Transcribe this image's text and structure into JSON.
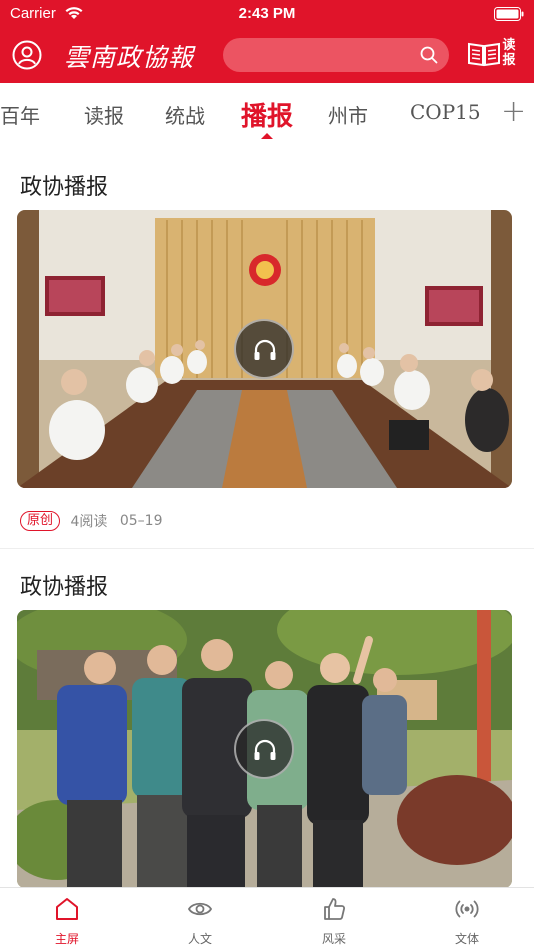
{
  "status_bar": {
    "carrier": "Carrier",
    "time": "2:43 PM"
  },
  "header": {
    "logo_text": "雲南政協報",
    "search": {
      "placeholder": ""
    },
    "read_label": "读报"
  },
  "channel_tabs": [
    {
      "label": "百年",
      "active": false
    },
    {
      "label": "读报",
      "active": false
    },
    {
      "label": "统战",
      "active": false
    },
    {
      "label": "播报",
      "active": true
    },
    {
      "label": "州市",
      "active": false
    },
    {
      "label": "COP15",
      "active": false
    }
  ],
  "add_channel_label": "+",
  "articles": [
    {
      "title": "政协播报",
      "image_semantic": "meeting-room-photo",
      "badge": "原创",
      "reads": "4阅读",
      "date": "05–19"
    },
    {
      "title": "政协播报",
      "image_semantic": "outdoor-inspection-photo"
    }
  ],
  "bottom_tabs": [
    {
      "label": "主屏",
      "icon": "home-icon",
      "active": true
    },
    {
      "label": "人文",
      "icon": "eye-icon",
      "active": false
    },
    {
      "label": "风采",
      "icon": "thumbs-up-icon",
      "active": false
    },
    {
      "label": "文体",
      "icon": "broadcast-icon",
      "active": false
    }
  ],
  "colors": {
    "brand_red": "#e0142a",
    "search_bg": "#ec5462"
  }
}
